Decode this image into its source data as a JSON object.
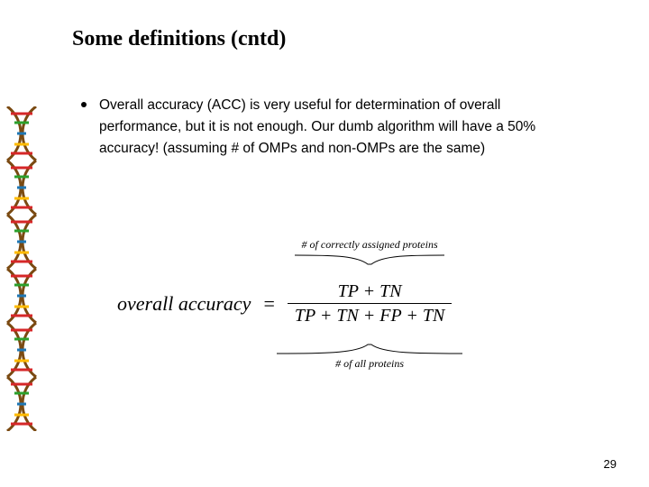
{
  "title": "Some definitions (cntd)",
  "bullet": "Overall accuracy (ACC) is very useful for determination of overall performance, but it is not enough. Our dumb algorithm will have a 50% accuracy! (assuming # of OMPs and non-OMPs are the same)",
  "formula": {
    "label": "overall accuracy",
    "numerator": "TP + TN",
    "denominator": "TP + TN + FP + TN",
    "top_annotation": "# of correctly assigned proteins",
    "bottom_annotation": "# of all proteins"
  },
  "page_number": "29"
}
